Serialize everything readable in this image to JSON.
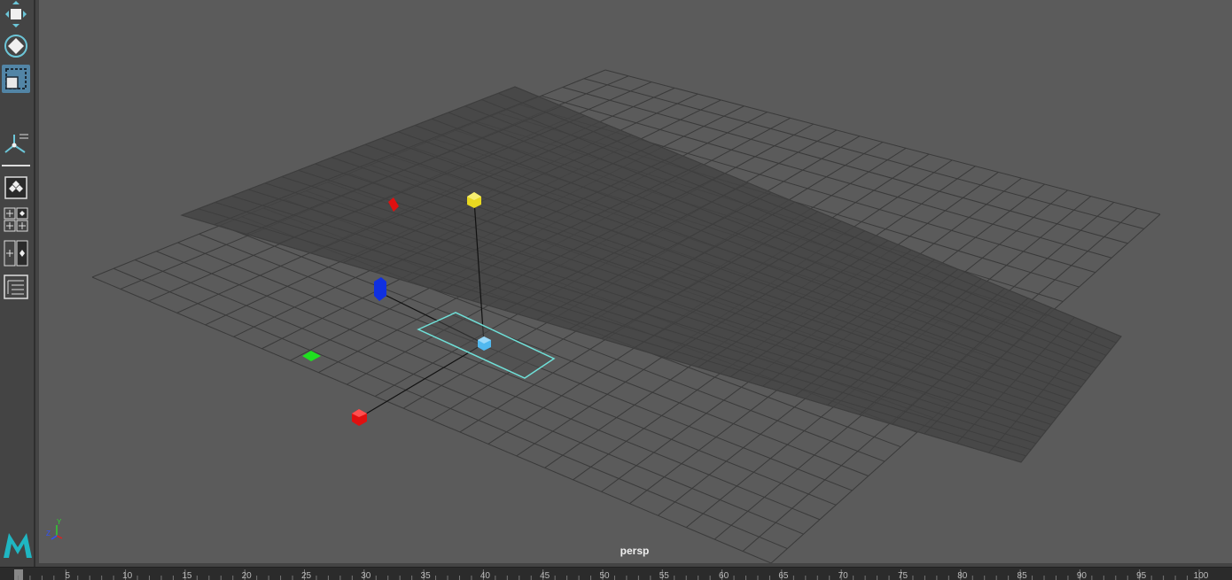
{
  "app": {
    "name": "Autodesk Maya"
  },
  "viewport": {
    "camera": "persp"
  },
  "axis_indicator": {
    "y": "Y",
    "z": "Z"
  },
  "toolbox": {
    "tools": [
      {
        "name": "move-tool",
        "active": false
      },
      {
        "name": "rotate-tool",
        "active": false
      },
      {
        "name": "scale-tool",
        "active": true
      },
      {
        "name": "show-manipulator-tool",
        "active": false
      },
      {
        "name": "single-perspective-view",
        "active": false
      },
      {
        "name": "four-view-layout",
        "active": false
      },
      {
        "name": "persp-outliner-layout",
        "active": false
      },
      {
        "name": "outliner",
        "active": false
      }
    ]
  },
  "timeline": {
    "frames": [
      5,
      10,
      15,
      20,
      25,
      30,
      35,
      40,
      45,
      50,
      55,
      60,
      65,
      70,
      75,
      80,
      85,
      90,
      95,
      100
    ],
    "current_frame": 1
  },
  "colors": {
    "viewport_bg": "#5b5b5b",
    "grid_line": "#3a3a3a",
    "selection": "#6fe0d8",
    "locator_red": "#e01010",
    "locator_yellow": "#e8d820",
    "locator_blue": "#1030e0",
    "locator_green": "#20e020",
    "locator_cyan": "#50b8ee"
  }
}
